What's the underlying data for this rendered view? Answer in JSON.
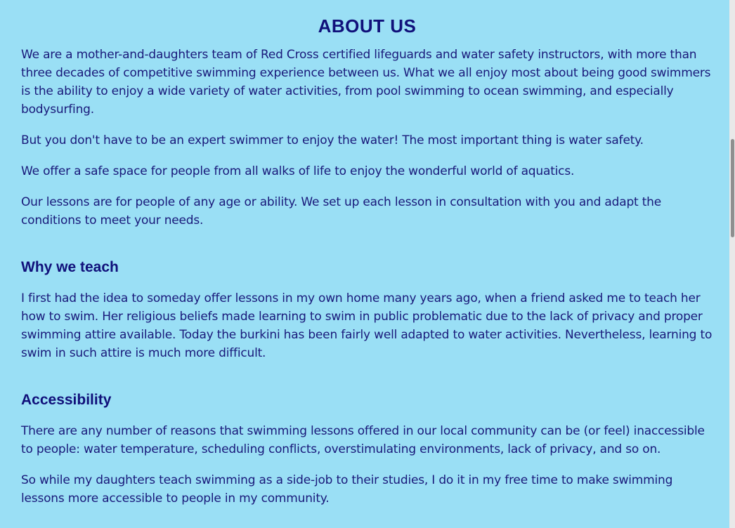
{
  "page": {
    "title": "ABOUT US"
  },
  "about": {
    "paragraphs": [
      "We are a mother-and-daughters team of Red Cross certified lifeguards and water safety instructors, with more than three decades of competitive swimming experience between us. What we all enjoy most about being good swimmers is the ability to enjoy a wide variety of water activities, from pool swimming to ocean swimming, and especially bodysurfing.",
      "But you don't have to be an expert swimmer to enjoy the water! The most important thing is water safety.",
      "We offer a safe space for people from all walks of life to enjoy the wonderful world of aquatics.",
      "Our lessons are for people of any age or ability. We set up each lesson in consultation with you and adapt the conditions to meet your needs."
    ]
  },
  "why_we_teach": {
    "heading": "Why we teach",
    "paragraphs": [
      "I first had the idea to someday offer lessons in my own home many years ago, when a friend asked me to teach her how to swim. Her religious beliefs made learning to swim in public problematic due to the lack of privacy and proper swimming attire available. Today the burkini has been fairly well adapted to water activities. Nevertheless, learning to swim in such attire is much more difficult."
    ]
  },
  "accessibility": {
    "heading": "Accessibility",
    "paragraphs": [
      "There are any number of reasons that swimming lessons offered in our local community can be (or feel) inaccessible to people: water temperature, scheduling conflicts, overstimulating environments, lack of privacy, and so on.",
      "So while my daughters teach swimming as a side-job to their studies, I do it in my free time to make swimming lessons more accessible to people in my community."
    ]
  },
  "colors": {
    "background": "#9adff5",
    "text": "#19197a",
    "heading": "#10107a"
  }
}
